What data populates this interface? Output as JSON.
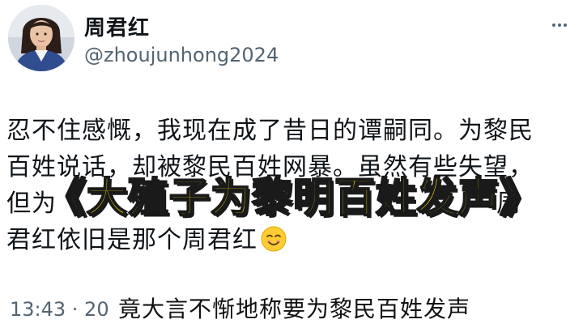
{
  "profile": {
    "display_name": "周君红",
    "handle": "@zhoujunhong2024",
    "avatar": "avatar-photo"
  },
  "header": {
    "more_icon": "more-horizontal-icon"
  },
  "tweet": {
    "lines": [
      "忍不住感慨，我现在成了昔日的谭嗣同。为黎民",
      "百姓说话，却被黎民百姓网暴。虽然有些失望，",
      "但为",
      "周",
      "君红依旧是那个周君红"
    ],
    "emoji": "smiling-face-emoji"
  },
  "overlay": {
    "title": "《大殖子为黎明百姓发声》",
    "color": "#ffde00",
    "stroke": "#1a1a1a"
  },
  "footer": {
    "timestamp": "13:43 · 20"
  },
  "caption": {
    "subtitle": "竟大言不惭地称要为黎民百姓发声"
  },
  "colors": {
    "text": "#0f1419",
    "muted": "#536471",
    "background": "#ffffff"
  }
}
